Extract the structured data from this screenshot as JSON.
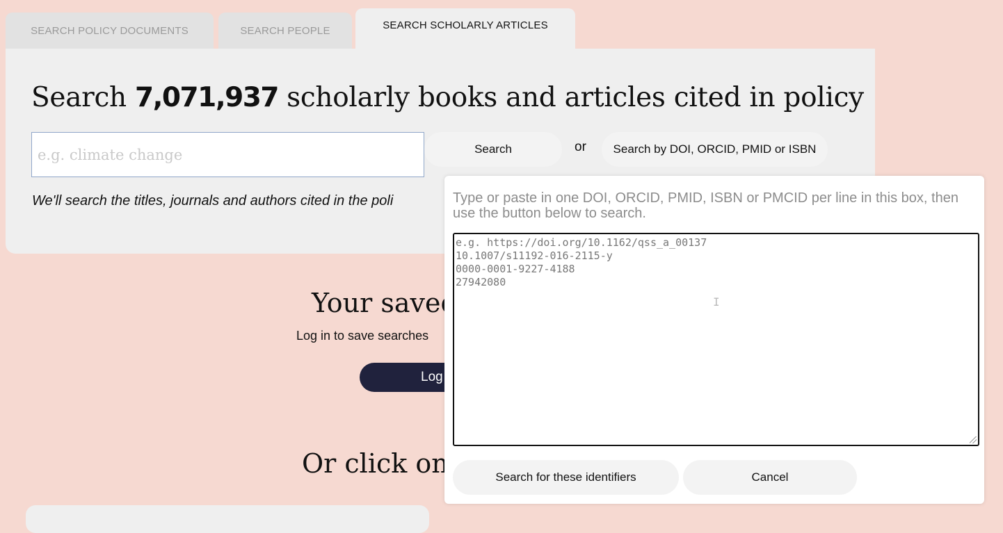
{
  "tabs": [
    {
      "label": "SEARCH POLICY DOCUMENTS"
    },
    {
      "label": "SEARCH PEOPLE"
    },
    {
      "label": "SEARCH SCHOLARLY ARTICLES"
    }
  ],
  "headline": {
    "prefix": "Search ",
    "count": "7,071,937",
    "suffix": " scholarly books and articles cited in policy"
  },
  "search": {
    "placeholder": "e.g. climate change",
    "button_label": "Search",
    "or_label": "or",
    "identifier_button_label": "Search by DOI, ORCID, PMID or ISBN"
  },
  "note": "We'll search the titles, journals and authors cited in the poli",
  "saved": {
    "title": "Your saved",
    "login_text": "Log in to save searches",
    "login_button_label": "Log"
  },
  "click_title": "Or click on",
  "identifier_popup": {
    "instruction": "Type or paste in one DOI, ORCID, PMID, ISBN or PMCID per line in this box, then use the button below to search.",
    "placeholder_lines": [
      "e.g. https://doi.org/10.1162/qss_a_00137",
      "10.1007/s11192-016-2115-y",
      "0000-0001-9227-4188",
      "27942080"
    ],
    "submit_label": "Search for these identifiers",
    "cancel_label": "Cancel"
  }
}
